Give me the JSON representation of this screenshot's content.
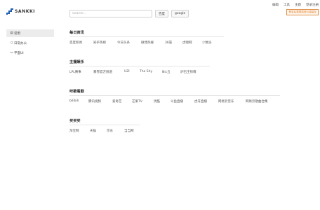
{
  "logo": {
    "text": "SANKKI"
  },
  "search": {
    "placeholder": "Search...",
    "engines": [
      "百度",
      "google"
    ]
  },
  "top_links": [
    "编辑",
    "工具",
    "主题",
    "登录注册"
  ],
  "notice": "登录后数据将被云端保存",
  "sidebar": {
    "items": [
      {
        "icon": "▤",
        "label": "常用"
      },
      {
        "icon": "▯",
        "label": "日常办公"
      },
      {
        "icon": "▭",
        "label": "平面UI"
      }
    ]
  },
  "sections": [
    {
      "title": "每日资讯",
      "links": [
        "百度新闻",
        "知乎热榜",
        "今日头条",
        "微博热搜",
        "36氪",
        "虎嗅网",
        "少数派"
      ]
    },
    {
      "title": "主播娱乐",
      "links": [
        "LPL赛事",
        "暴雪官方频道",
        "UZI",
        "The Shy",
        "Nic丘",
        "炉石王师傅"
      ]
    },
    {
      "title": "听歌看剧",
      "links": [
        "bilibili",
        "腾讯视频",
        "爱奇艺",
        "芒果TV",
        "优酷",
        "斗鱼直播",
        "虎牙直播",
        "网易云音乐",
        "网易云歌曲合集"
      ]
    },
    {
      "title": "买买买",
      "links": [
        "淘宝网",
        "天猫",
        "京东",
        "当当网"
      ]
    }
  ]
}
